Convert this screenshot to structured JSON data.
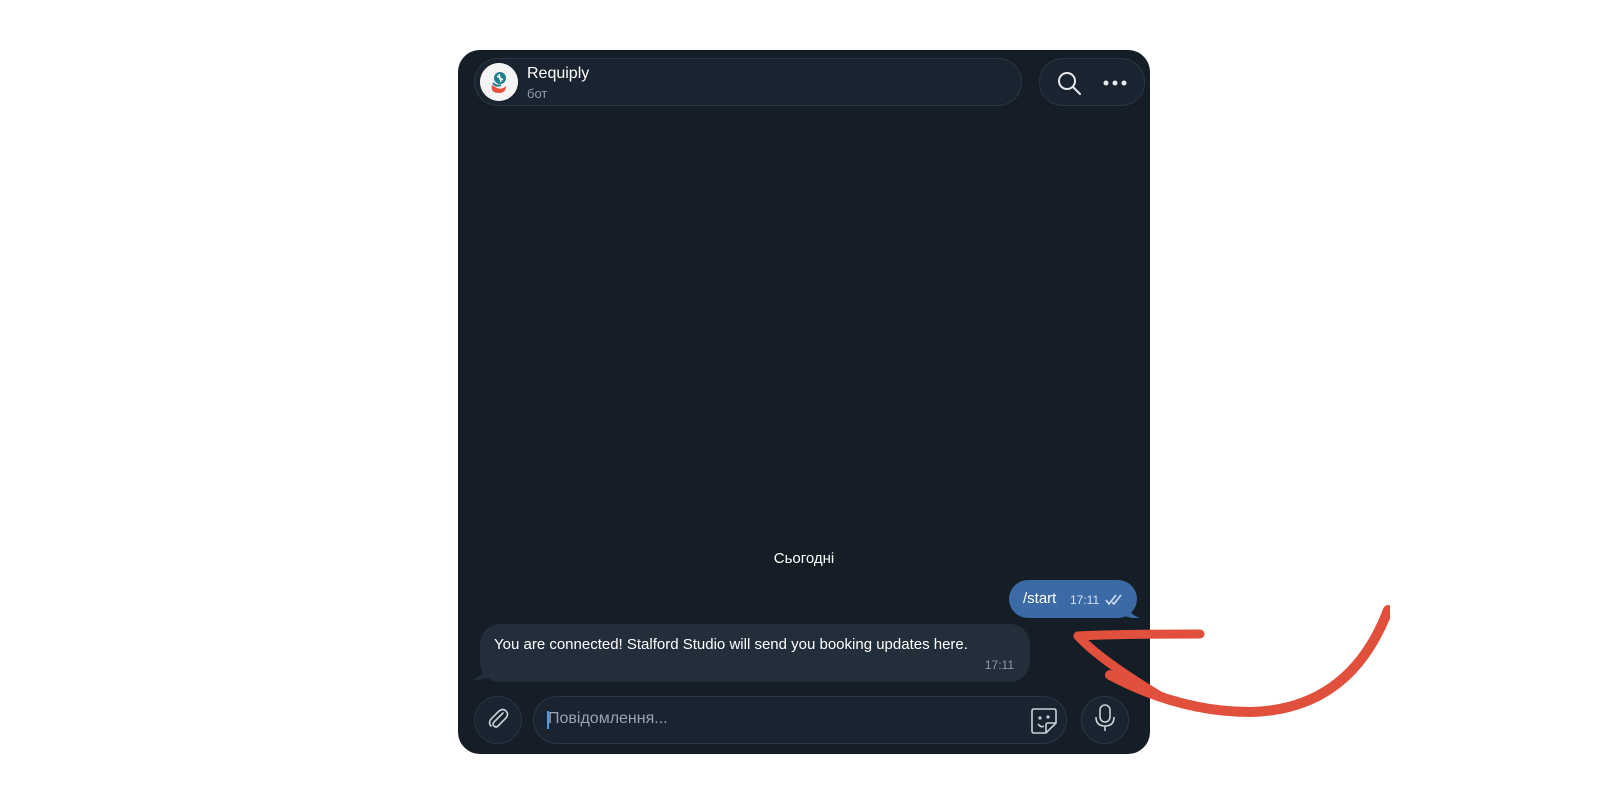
{
  "chat": {
    "title": "Requiply",
    "subtitle": "бот"
  },
  "date_divider": "Сьогодні",
  "messages": [
    {
      "direction": "outgoing",
      "text": "/start",
      "time": "17:11",
      "status": "read"
    },
    {
      "direction": "incoming",
      "text": "You are connected! Stalford Studio  will send you booking updates here.",
      "time": "17:11"
    }
  ],
  "composer": {
    "placeholder": "Повідомлення..."
  },
  "icons": [
    "search-icon",
    "more-icon",
    "attach-icon",
    "sticker-icon",
    "microphone-icon",
    "bot-avatar",
    "read-checks-icon"
  ],
  "colors": {
    "background": "#151d26",
    "outgoing_bubble": "#3c6aa6",
    "incoming_bubble": "#232e3b",
    "annotation_arrow": "#e0503c"
  }
}
